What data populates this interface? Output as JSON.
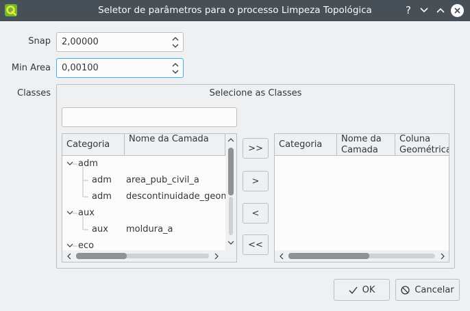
{
  "window": {
    "title": "Seletor de parâmetros para o processo Limpeza Topológica",
    "help_glyph": "?"
  },
  "snap": {
    "label": "Snap",
    "value": "2,00000"
  },
  "min_area": {
    "label": "Min Area",
    "value": "0,00100"
  },
  "classes": {
    "label": "Classes",
    "group_title": "Selecione as Classes",
    "filter_value": "",
    "left_tree": {
      "headers": [
        "Categoria",
        "Nome da Camada"
      ],
      "rows": [
        {
          "type": "group",
          "name": "adm"
        },
        {
          "type": "child",
          "category": "adm",
          "layer": "area_pub_civil_a"
        },
        {
          "type": "child",
          "category": "adm",
          "layer": "descontinuidade_geom"
        },
        {
          "type": "group",
          "name": "aux"
        },
        {
          "type": "child",
          "category": "aux",
          "layer": "moldura_a"
        },
        {
          "type": "group",
          "name": "eco"
        }
      ]
    },
    "right_tree": {
      "headers": [
        "Categoria",
        "Nome da Camada",
        "Coluna Geométrica"
      ]
    },
    "transfer_buttons": [
      ">>",
      ">",
      "<",
      "<<"
    ]
  },
  "footer": {
    "ok_label": "OK",
    "cancel_label": "Cancelar"
  },
  "colors": {
    "titlebar": "#475057",
    "background": "#eff0f1",
    "focus": "#3daee9",
    "qgis_green": "#6fb82d",
    "qgis_yellow": "#f0e442"
  }
}
